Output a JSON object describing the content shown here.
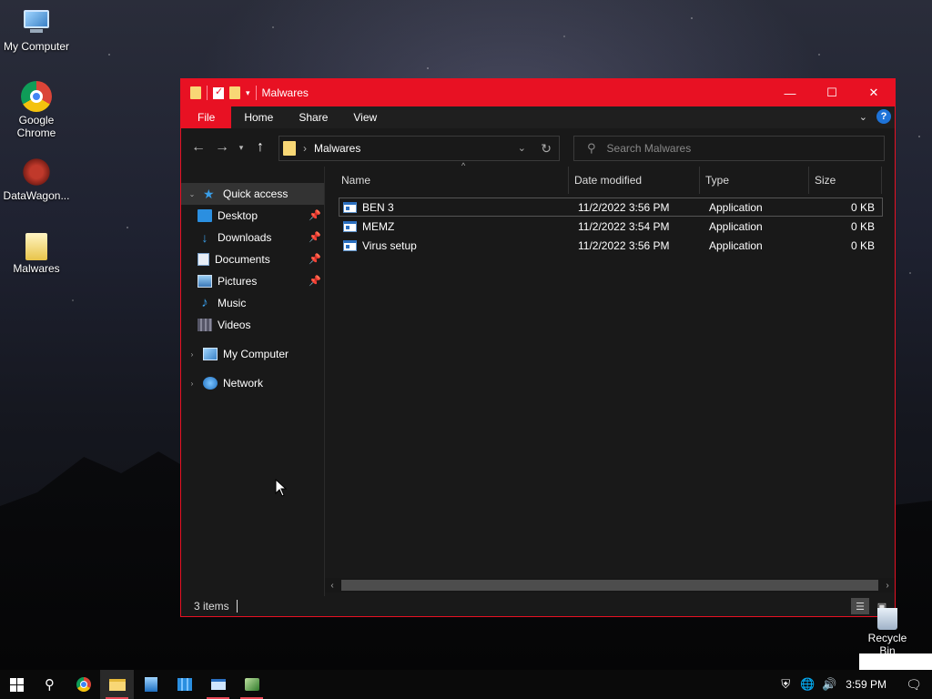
{
  "desktop": {
    "icons": [
      {
        "label": "My Computer"
      },
      {
        "label": "Google Chrome"
      },
      {
        "label": "DataWagon..."
      },
      {
        "label": "Malwares"
      }
    ],
    "recycle_bin": "Recycle Bin"
  },
  "window": {
    "title": "Malwares",
    "controls": {
      "minimize": "—",
      "maximize": "☐",
      "close": "✕"
    },
    "accent": "#e81123",
    "ribbon": {
      "tabs": [
        "File",
        "Home",
        "Share",
        "View"
      ],
      "help": "?"
    },
    "address": {
      "path": "Malwares"
    },
    "search": {
      "placeholder": "Search Malwares"
    },
    "nav_pane": {
      "quick_access": "Quick access",
      "items": [
        {
          "label": "Desktop",
          "pinned": true
        },
        {
          "label": "Downloads",
          "pinned": true
        },
        {
          "label": "Documents",
          "pinned": true
        },
        {
          "label": "Pictures",
          "pinned": true
        },
        {
          "label": "Music",
          "pinned": false
        },
        {
          "label": "Videos",
          "pinned": false
        }
      ],
      "my_computer": "My Computer",
      "network": "Network"
    },
    "columns": {
      "name": "Name",
      "date": "Date modified",
      "type": "Type",
      "size": "Size"
    },
    "files": [
      {
        "name": "BEN 3",
        "date": "11/2/2022 3:56 PM",
        "type": "Application",
        "size": "0 KB"
      },
      {
        "name": "MEMZ",
        "date": "11/2/2022 3:54 PM",
        "type": "Application",
        "size": "0 KB"
      },
      {
        "name": "Virus setup",
        "date": "11/2/2022 3:56 PM",
        "type": "Application",
        "size": "0 KB"
      }
    ],
    "status": {
      "items_count": "3 items"
    }
  },
  "taskbar": {
    "clock": "3:59 PM"
  }
}
